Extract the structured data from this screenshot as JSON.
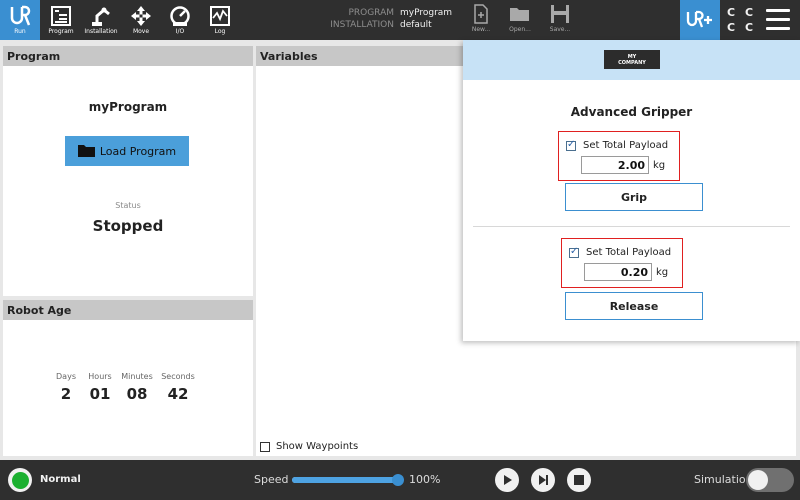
{
  "nav": [
    {
      "label": "Run",
      "icon": "ur-logo-icon",
      "active": true
    },
    {
      "label": "Program",
      "icon": "program-tree-icon"
    },
    {
      "label": "Installation",
      "icon": "robot-arm-icon"
    },
    {
      "label": "Move",
      "icon": "move-arrows-icon"
    },
    {
      "label": "I/O",
      "icon": "io-gauge-icon"
    },
    {
      "label": "Log",
      "icon": "log-graph-icon"
    }
  ],
  "program_info": {
    "program_key": "PROGRAM",
    "program_value": "myProgram",
    "installation_key": "INSTALLATION",
    "installation_value": "default"
  },
  "file_buttons": {
    "new": "New...",
    "open": "Open...",
    "save": "Save..."
  },
  "cc_labels": [
    "C",
    "C",
    "C",
    "C"
  ],
  "program_panel": {
    "title": "Program",
    "program_name": "myProgram",
    "load_button": "Load Program",
    "status_label": "Status",
    "status_value": "Stopped"
  },
  "robot_age": {
    "title": "Robot Age",
    "labels": {
      "days": "Days",
      "hours": "Hours",
      "minutes": "Minutes",
      "seconds": "Seconds"
    },
    "values": {
      "days": "2",
      "hours": "01",
      "minutes": "08",
      "seconds": "42"
    }
  },
  "variables_panel": {
    "title": "Variables",
    "show_waypoints": "Show Waypoints"
  },
  "gripper_overlay": {
    "logo_line1": "MY",
    "logo_line2": "COMPANY",
    "title": "Advanced Gripper",
    "grip": {
      "payload_label": "Set Total Payload",
      "payload_value": "2.00",
      "unit": "kg",
      "button": "Grip",
      "checked": true
    },
    "release": {
      "payload_label": "Set Total Payload",
      "payload_value": "0.20",
      "unit": "kg",
      "button": "Release",
      "checked": true
    }
  },
  "bottom_bar": {
    "mode": "Normal",
    "speed_label": "Speed",
    "speed_value": "100%",
    "speed_fraction": 1.0,
    "simulation_label": "Simulation",
    "simulation_on": false
  },
  "colors": {
    "accent": "#3a8fd1",
    "bar": "#2f2f2f",
    "panel_header": "#c7c7c7",
    "status_green": "#1bb030",
    "highlight_red": "#e02020"
  }
}
